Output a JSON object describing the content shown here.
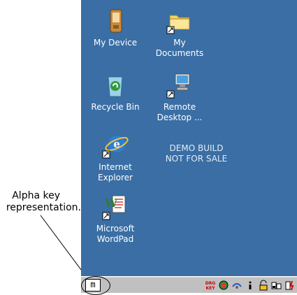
{
  "annotation": {
    "line1": "Alpha key",
    "line2": "representation."
  },
  "desktop": {
    "icons": [
      {
        "label": "My Device",
        "icon": "pda-device-icon"
      },
      {
        "label": "My\nDocuments",
        "icon": "folder-icon"
      },
      {
        "label": "Recycle Bin",
        "icon": "recycle-bin-icon"
      },
      {
        "label": "Remote\nDesktop ...",
        "icon": "remote-desktop-icon"
      },
      {
        "label": "Internet\nExplorer",
        "icon": "internet-explorer-icon"
      },
      {
        "label": "Microsoft\nWordPad",
        "icon": "wordpad-icon"
      }
    ],
    "watermark": "DEMO BUILD\nNOT FOR SALE",
    "background_color": "#3a6ea5"
  },
  "taskbar": {
    "alpha_key": "m",
    "tray_icons": [
      "drag-key-icon",
      "network-icon",
      "connection-icon",
      "info-icon",
      "lock-icon",
      "battery-icon",
      "power-icon"
    ]
  }
}
